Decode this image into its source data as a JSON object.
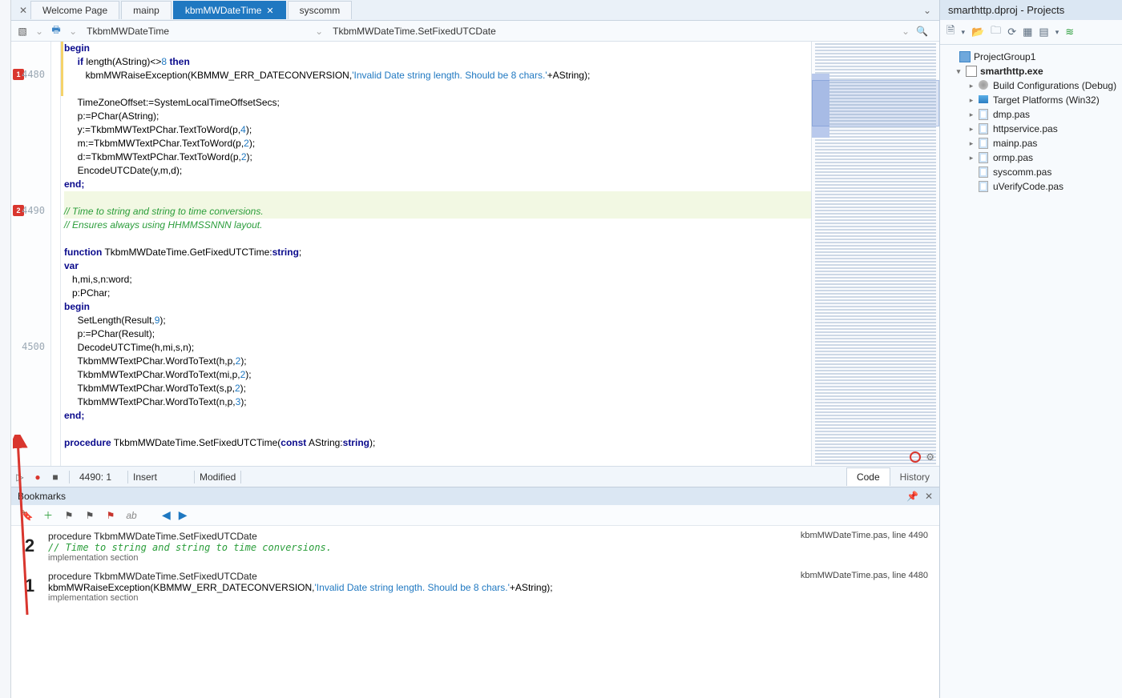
{
  "tabs": {
    "items": [
      {
        "label": "Welcome Page",
        "active": false
      },
      {
        "label": "mainp",
        "active": false
      },
      {
        "label": "kbmMWDateTime",
        "active": true
      },
      {
        "label": "syscomm",
        "active": false
      }
    ]
  },
  "nav": {
    "unit": "TkbmMWDateTime",
    "member": "TkbmMWDateTime.SetFixedUTCDate"
  },
  "gutter": {
    "bm1_line": "4480",
    "bm2_line": "4490",
    "ln4500": "4500"
  },
  "code": {
    "l1": "begin",
    "l2": "     if length(AString)<>8 then",
    "l3": "        kbmMWRaiseException(KBMMW_ERR_DATECONVERSION,'Invalid Date string length. Should be 8 chars.'+AString);",
    "l3_str": "'Invalid Date string length. Should be 8 chars.'",
    "l4": "",
    "l5": "     TimeZoneOffset:=SystemLocalTimeOffsetSecs;",
    "l6": "     p:=PChar(AString);",
    "l7": "     y:=TkbmMWTextPChar.TextToWord(p,4);",
    "l8": "     m:=TkbmMWTextPChar.TextToWord(p,2);",
    "l9": "     d:=TkbmMWTextPChar.TextToWord(p,2);",
    "l10": "     EncodeUTCDate(y,m,d);",
    "l11": "end;",
    "l12": "",
    "l13": "// Time to string and string to time conversions.",
    "l14": "// Ensures always using HHMMSSNNN layout.",
    "l15": "",
    "l16": "function TkbmMWDateTime.GetFixedUTCTime:string;",
    "l17": "var",
    "l18": "   h,mi,s,n:word;",
    "l19": "   p:PChar;",
    "l20": "begin",
    "l21": "     SetLength(Result,9);",
    "l22": "     p:=PChar(Result);",
    "l23": "     DecodeUTCTime(h,mi,s,n);",
    "l24": "     TkbmMWTextPChar.WordToText(h,p,2);",
    "l25": "     TkbmMWTextPChar.WordToText(mi,p,2);",
    "l26": "     TkbmMWTextPChar.WordToText(s,p,2);",
    "l27": "     TkbmMWTextPChar.WordToText(n,p,3);",
    "l28": "end;",
    "l29": "",
    "l30": "procedure TkbmMWDateTime.SetFixedUTCTime(const AString:string);"
  },
  "status": {
    "pos": "4490:  1",
    "mode": "Insert",
    "mod": "Modified",
    "view_code": "Code",
    "view_history": "History"
  },
  "bookmarks": {
    "title": "Bookmarks",
    "ab": "ab",
    "items": [
      {
        "num": "2",
        "proc": "procedure TkbmMWDateTime.SetFixedUTCDate",
        "code": "// Time to string and string to time conversions.",
        "code_class": "s-cmt",
        "section": "implementation section",
        "loc": "kbmMWDateTime.pas, line 4490"
      },
      {
        "num": "1",
        "proc": "procedure TkbmMWDateTime.SetFixedUTCDate",
        "code": "kbmMWRaiseException(KBMMW_ERR_DATECONVERSION,'Invalid Date string length. Should be 8 chars.'+AString);",
        "code_class": "",
        "section": "implementation section",
        "loc": "kbmMWDateTime.pas, line 4480"
      }
    ]
  },
  "projects": {
    "title": "smarthttp.dproj - Projects",
    "nodes": [
      {
        "indent": 6,
        "twist": "",
        "icon": "ic-proj",
        "label": "ProjectGroup1",
        "bold": false
      },
      {
        "indent": 14,
        "twist": "▾",
        "icon": "ic-exe",
        "label": "smarthttp.exe",
        "bold": true
      },
      {
        "indent": 30,
        "twist": "▸",
        "icon": "ic-cfg",
        "label": "Build Configurations (Debug)",
        "bold": false
      },
      {
        "indent": 30,
        "twist": "▸",
        "icon": "ic-plat",
        "label": "Target Platforms (Win32)",
        "bold": false
      },
      {
        "indent": 30,
        "twist": "▸",
        "icon": "ic-pas",
        "label": "dmp.pas",
        "bold": false
      },
      {
        "indent": 30,
        "twist": "▸",
        "icon": "ic-pas",
        "label": "httpservice.pas",
        "bold": false
      },
      {
        "indent": 30,
        "twist": "▸",
        "icon": "ic-pas",
        "label": "mainp.pas",
        "bold": false
      },
      {
        "indent": 30,
        "twist": "▸",
        "icon": "ic-pas",
        "label": "ormp.pas",
        "bold": false
      },
      {
        "indent": 30,
        "twist": "",
        "icon": "ic-pas",
        "label": "syscomm.pas",
        "bold": false
      },
      {
        "indent": 30,
        "twist": "",
        "icon": "ic-pas",
        "label": "uVerifyCode.pas",
        "bold": false
      }
    ]
  }
}
